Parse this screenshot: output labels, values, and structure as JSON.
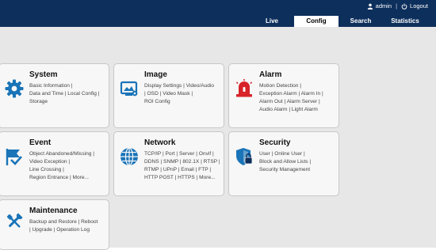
{
  "header": {
    "user": "admin",
    "logout": "Logout",
    "separator": "|"
  },
  "tabs": [
    {
      "label": "Live"
    },
    {
      "label": "Config"
    },
    {
      "label": "Search"
    },
    {
      "label": "Statistics"
    }
  ],
  "active_tab": "Config",
  "cards": {
    "system": {
      "title": "System",
      "items": [
        "Basic Information |",
        "Data and Time | Local Config |",
        "Storage"
      ]
    },
    "image": {
      "title": "Image",
      "items": [
        "Display Settings | Video/Audio",
        "| OSD | Video Mask |",
        "ROI Config"
      ]
    },
    "alarm": {
      "title": "Alarm",
      "items": [
        "Motion Detection |",
        "Exception Alarm | Alarm In |",
        "Alarm Out | Alarm Server |",
        "Audio Alarm | Light Alarm"
      ]
    },
    "event": {
      "title": "Event",
      "items": [
        "Object Abandoned/Missing |",
        "Video Exception |",
        "Line Crossing |",
        "Region Entrance | More..."
      ]
    },
    "network": {
      "title": "Network",
      "items": [
        "TCP/IP | Port | Server | Onvif |",
        "DDNS | SNMP | 802.1X | RTSP |",
        "RTMP | UPnP | Email | FTP |",
        "HTTP POST | HTTPS | More..."
      ]
    },
    "security": {
      "title": "Security",
      "items": [
        "User | Online User |",
        "Block and Allow Lists |",
        "Security Management"
      ]
    },
    "maintenance": {
      "title": "Maintenance",
      "items": [
        "Backup and Restore | Reboot",
        "| Upgrade | Operation Log"
      ]
    }
  },
  "colors": {
    "header_bg": "#0d2f5c",
    "content_bg": "#e7e7e7",
    "icon_blue": "#1a74b8",
    "icon_red": "#d8232a"
  },
  "icons": {
    "system": "gear-icon",
    "image": "image-settings-icon",
    "alarm": "alarm-siren-icon",
    "event": "event-flag-icon",
    "network": "globe-icon",
    "security": "shield-lock-icon",
    "maintenance": "wrench-screwdriver-icon"
  }
}
